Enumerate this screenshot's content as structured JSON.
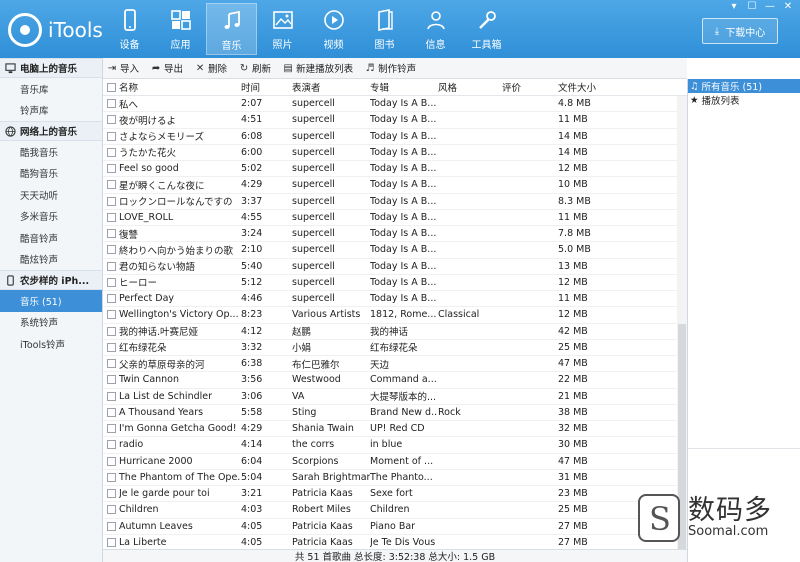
{
  "app": {
    "logo_text": "iTools"
  },
  "window_controls": [
    "▾",
    "☐",
    "—",
    "✕"
  ],
  "nav": [
    {
      "label": "设备",
      "icon": "phone-icon"
    },
    {
      "label": "应用",
      "icon": "apps-icon"
    },
    {
      "label": "音乐",
      "icon": "music-icon"
    },
    {
      "label": "照片",
      "icon": "photo-icon"
    },
    {
      "label": "视频",
      "icon": "video-icon"
    },
    {
      "label": "图书",
      "icon": "book-icon"
    },
    {
      "label": "信息",
      "icon": "contacts-icon"
    },
    {
      "label": "工具箱",
      "icon": "toolbox-icon"
    }
  ],
  "download_center": "下载中心",
  "sidebar": {
    "sections": [
      {
        "title": "电脑上的音乐",
        "icon": "computer-icon",
        "items": [
          "音乐库",
          "铃声库"
        ]
      },
      {
        "title": "网络上的音乐",
        "icon": "globe-icon",
        "items": [
          "酷我音乐",
          "酷狗音乐",
          "天天动听",
          "多米音乐",
          "酷音铃声",
          "酷炫铃声"
        ]
      },
      {
        "title": "农步样的 iPh...",
        "icon": "device-icon",
        "items": [
          "音乐 (51)",
          "系统铃声",
          "iTools铃声"
        ]
      }
    ],
    "active": "音乐 (51)"
  },
  "toolbar": [
    {
      "label": "导入",
      "icon": "import-icon",
      "glyph": "⇥"
    },
    {
      "label": "导出",
      "icon": "export-icon",
      "glyph": "➦"
    },
    {
      "label": "删除",
      "icon": "delete-icon",
      "glyph": "✕"
    },
    {
      "label": "刷新",
      "icon": "refresh-icon",
      "glyph": "↻"
    },
    {
      "label": "新建播放列表",
      "icon": "new-playlist-icon",
      "glyph": "▤"
    },
    {
      "label": "制作铃声",
      "icon": "ringtone-icon",
      "glyph": "♬"
    }
  ],
  "table": {
    "columns": [
      "名称",
      "时间",
      "表演者",
      "专辑",
      "风格",
      "评价",
      "文件大小"
    ],
    "rows": [
      [
        "私へ",
        "2:07",
        "supercell",
        "Today Is A B...",
        "",
        "",
        "4.8 MB"
      ],
      [
        "夜が明けるよ",
        "4:51",
        "supercell",
        "Today Is A B...",
        "",
        "",
        "11 MB"
      ],
      [
        "さよならメモリーズ",
        "6:08",
        "supercell",
        "Today Is A B...",
        "",
        "",
        "14 MB"
      ],
      [
        "うたかた花火",
        "6:00",
        "supercell",
        "Today Is A B...",
        "",
        "",
        "14 MB"
      ],
      [
        "Feel so good",
        "5:02",
        "supercell",
        "Today Is A B...",
        "",
        "",
        "12 MB"
      ],
      [
        "星が瞬くこんな夜に",
        "4:29",
        "supercell",
        "Today Is A B...",
        "",
        "",
        "10 MB"
      ],
      [
        "ロックンロールなんですの",
        "3:37",
        "supercell",
        "Today Is A B...",
        "",
        "",
        "8.3 MB"
      ],
      [
        "LOVE_ROLL",
        "4:55",
        "supercell",
        "Today Is A B...",
        "",
        "",
        "11 MB"
      ],
      [
        "復讐",
        "3:24",
        "supercell",
        "Today Is A B...",
        "",
        "",
        "7.8 MB"
      ],
      [
        "終わりへ向かう始まりの歌",
        "2:10",
        "supercell",
        "Today Is A B...",
        "",
        "",
        "5.0 MB"
      ],
      [
        "君の知らない物語",
        "5:40",
        "supercell",
        "Today Is A B...",
        "",
        "",
        "13 MB"
      ],
      [
        "ヒーロー",
        "5:12",
        "supercell",
        "Today Is A B...",
        "",
        "",
        "12 MB"
      ],
      [
        "Perfect Day",
        "4:46",
        "supercell",
        "Today Is A B...",
        "",
        "",
        "11 MB"
      ],
      [
        "Wellington's Victory Op...",
        "8:23",
        "Various Artists",
        "1812, Rome...",
        "Classical",
        "",
        "12 MB"
      ],
      [
        "我的神话.叶赛尼娅",
        "4:12",
        "赵鹏",
        "我的神话",
        "",
        "",
        "42 MB"
      ],
      [
        "红布绿花朵",
        "3:32",
        "小娟",
        "红布绿花朵",
        "",
        "",
        "25 MB"
      ],
      [
        "父亲的草原母亲的河",
        "6:38",
        "布仁巴雅尔",
        "天边",
        "",
        "",
        "47 MB"
      ],
      [
        "Twin Cannon",
        "3:56",
        "Westwood",
        "Command a...",
        "",
        "",
        "22 MB"
      ],
      [
        "La List de Schindler",
        "3:06",
        "VA",
        "大提琴版本的...",
        "",
        "",
        "21 MB"
      ],
      [
        "A Thousand Years",
        "5:58",
        "Sting",
        "Brand New d...",
        "Rock",
        "",
        "38 MB"
      ],
      [
        "I'm Gonna Getcha Good!",
        "4:29",
        "Shania Twain",
        "UP! Red CD",
        "",
        "",
        "32 MB"
      ],
      [
        "radio",
        "4:14",
        "the corrs",
        "in blue",
        "",
        "",
        "30 MB"
      ],
      [
        "Hurricane 2000",
        "6:04",
        "Scorpions",
        "Moment of ...",
        "",
        "",
        "47 MB"
      ],
      [
        "The Phantom of The Ope...",
        "5:04",
        "Sarah Brightman",
        "The Phanto...",
        "",
        "",
        "31 MB"
      ],
      [
        "Je le garde pour toi",
        "3:21",
        "Patricia Kaas",
        "Sexe fort",
        "",
        "",
        "23 MB"
      ],
      [
        "Children",
        "4:03",
        "Robert Miles",
        "Children",
        "",
        "",
        "25 MB"
      ],
      [
        "Autumn Leaves",
        "4:05",
        "Patricia Kaas",
        "Piano Bar",
        "",
        "",
        "27 MB"
      ],
      [
        "La Liberte",
        "4:05",
        "Patricia Kaas",
        "Je Te Dis Vous",
        "",
        "",
        "27 MB"
      ]
    ]
  },
  "status": "共 51 首歌曲  总长度: 3:52:38  总大小: 1.5 GB",
  "right_panel": [
    {
      "label": "所有音乐 (51)",
      "icon": "music-note-icon",
      "glyph": "♫"
    },
    {
      "label": "播放列表",
      "icon": "star-icon",
      "glyph": "★"
    }
  ],
  "watermark": {
    "cn": "数码多",
    "en": "Soomal.com"
  },
  "colors": {
    "header": "#3a9be0",
    "accent": "#3d8fd8"
  }
}
